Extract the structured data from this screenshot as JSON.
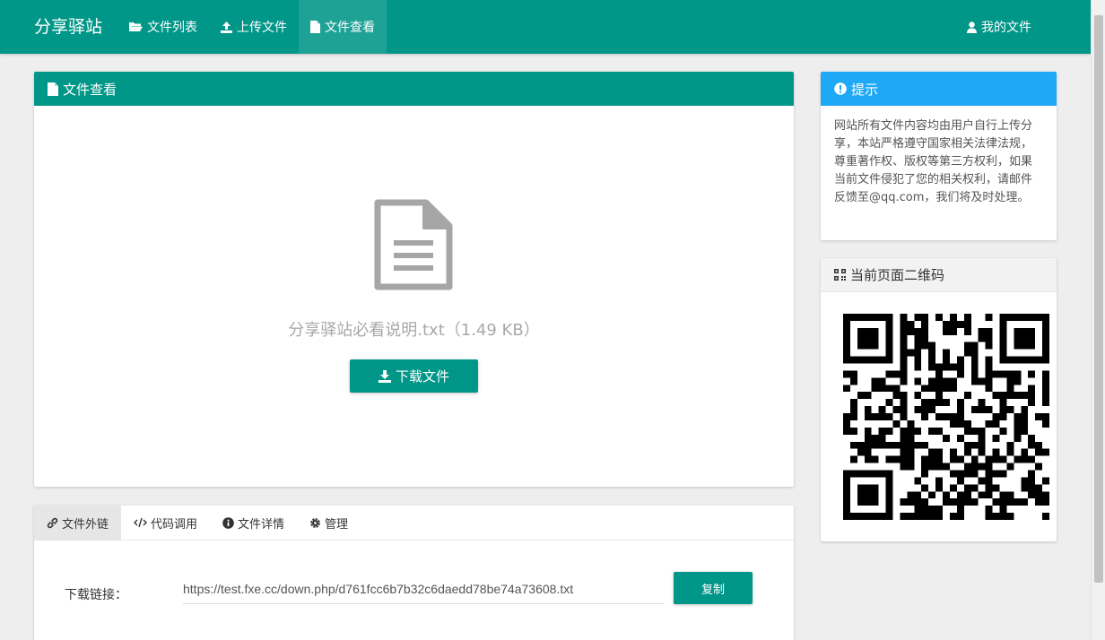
{
  "brand": "分享驿站",
  "nav": {
    "items": [
      {
        "label": "文件列表",
        "icon": "folder-open-icon"
      },
      {
        "label": "上传文件",
        "icon": "upload-icon"
      },
      {
        "label": "文件查看",
        "icon": "file-icon",
        "active": true
      }
    ],
    "my_files": "我的文件"
  },
  "file_panel": {
    "title": "文件查看",
    "file_name": "分享驿站必看说明.txt（1.49 KB）",
    "download_label": "下载文件"
  },
  "tabs": [
    {
      "label": "文件外链",
      "icon": "link-icon",
      "active": true
    },
    {
      "label": "代码调用",
      "icon": "code-icon"
    },
    {
      "label": "文件详情",
      "icon": "info-circle-icon"
    },
    {
      "label": "管理",
      "icon": "gear-icon"
    }
  ],
  "link": {
    "label": "下载链接：",
    "value": "https://test.fxe.cc/down.php/d761fcc6b7b32c6daedd78be74a73608.txt",
    "copy_label": "复制"
  },
  "notice": {
    "title": "提示",
    "text": "网站所有文件内容均由用户自行上传分享，本站严格遵守国家相关法律法规，尊重著作权、版权等第三方权利，如果当前文件侵犯了您的相关权利，请邮件反馈至@qq.com，我们将及时处理。"
  },
  "qr": {
    "title": "当前页面二维码"
  },
  "colors": {
    "primary": "#009688",
    "info": "#1fa8f6",
    "background": "#eeeeee"
  }
}
